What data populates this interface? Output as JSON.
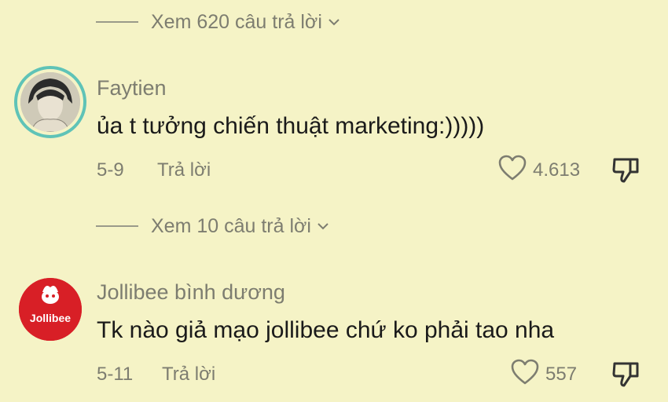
{
  "top_replies": {
    "label": "Xem 620 câu trả lời"
  },
  "comments": [
    {
      "username": "Faytien",
      "text": "ủa t tưởng chiến thuật marketing:)))))",
      "date": "5-9",
      "reply_label": "Trả lời",
      "likes": "4.613",
      "replies_label": "Xem 10 câu trả lời"
    },
    {
      "username": "Jollibee bình dương",
      "avatar_text": "Jollibee",
      "text": "Tk nào giả mạo jollibee chứ ko phải tao nha",
      "date": "5-11",
      "reply_label": "Trả lời",
      "likes": "557"
    }
  ],
  "colors": {
    "background": "#f5f3c6",
    "muted_text": "#7d7d70",
    "avatar_ring": "#5fc3b7",
    "jollibee_red": "#d81f26"
  },
  "icons": [
    "chevron-down-icon",
    "heart-icon",
    "thumbs-down-icon"
  ]
}
